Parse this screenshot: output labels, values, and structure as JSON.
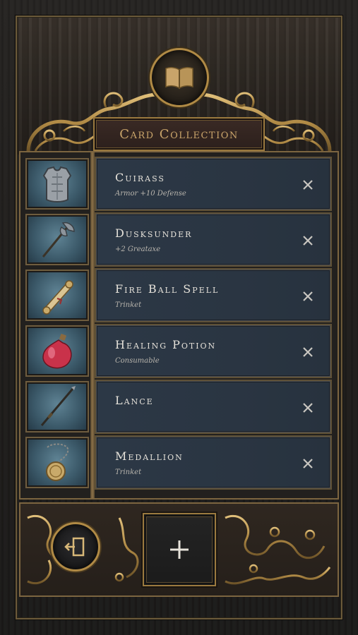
{
  "header": {
    "title": "Card Collection",
    "icon": "open-book-icon"
  },
  "cards": [
    {
      "name": "Cuirass",
      "subtitle": "Armor +10 Defense",
      "icon": "cuirass-icon"
    },
    {
      "name": "Dusksunder",
      "subtitle": "+2 Greataxe",
      "icon": "greataxe-icon"
    },
    {
      "name": "Fire Ball Spell",
      "subtitle": "Trinket",
      "icon": "scroll-icon"
    },
    {
      "name": "Healing Potion",
      "subtitle": "Consumable",
      "icon": "potion-icon"
    },
    {
      "name": "Lance",
      "subtitle": "",
      "icon": "lance-icon"
    },
    {
      "name": "Medallion",
      "subtitle": "Trinket",
      "icon": "medallion-icon"
    }
  ],
  "footer": {
    "exit_icon": "exit-door-icon",
    "add_icon": "plus-icon"
  },
  "colors": {
    "gold": "#b08a45",
    "title_text": "#c9a46a",
    "card_bg": "#2c3846",
    "thumb_bg": "#5f8394"
  }
}
